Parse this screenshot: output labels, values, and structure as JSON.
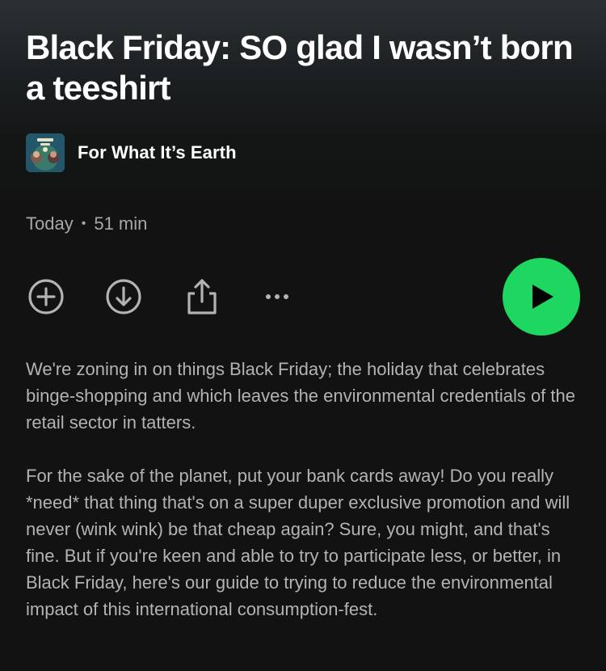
{
  "episode": {
    "title": "Black Friday: SO glad I wasn’t born a teeshirt"
  },
  "show": {
    "name": "For What It’s Earth"
  },
  "meta": {
    "date": "Today",
    "separator": "•",
    "duration": "51 min"
  },
  "actions": {
    "add_icon": "plus-circle-icon",
    "download_icon": "download-circle-icon",
    "share_icon": "share-icon",
    "more_icon": "more-horizontal-icon",
    "play_icon": "play-icon"
  },
  "colors": {
    "background": "#121212",
    "accent": "#1ed760",
    "secondary_text": "#a7a7a7"
  },
  "description": {
    "paragraph_1": "We're zoning in on things Black Friday; the holiday that celebrates binge-shopping and which leaves the environmental credentials of the retail sector in tatters.",
    "paragraph_2": "For the sake of the planet, put your bank cards away! Do you really *need* that thing that's on a super duper exclusive promotion and will never (wink wink) be that cheap again? Sure, you might, and that's fine. But if you're keen and able to try to participate less, or better, in Black Friday, here's our guide to trying to reduce the environmental impact of this international consumption-fest."
  }
}
